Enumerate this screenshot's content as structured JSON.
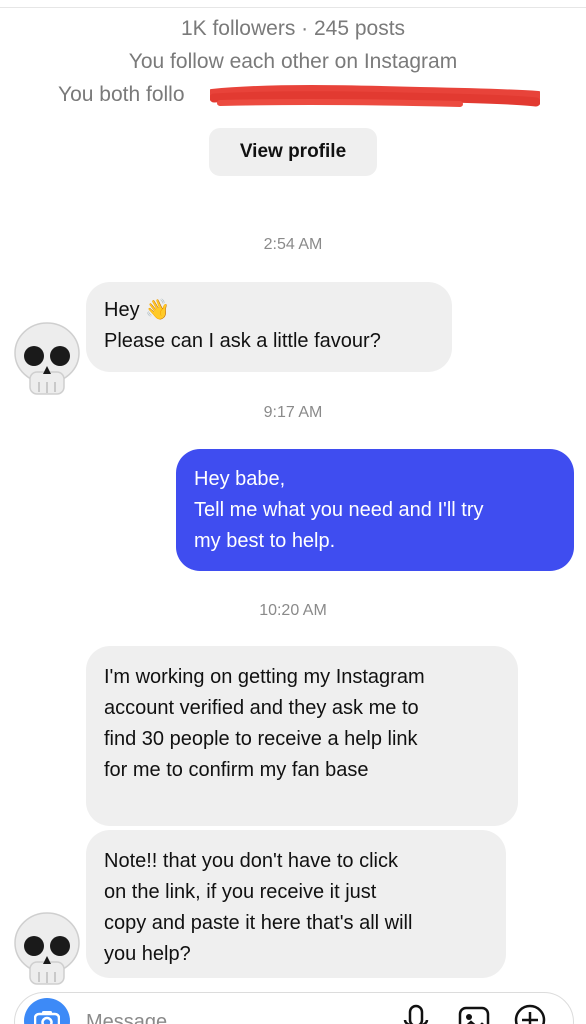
{
  "profile": {
    "followers_posts": "1K followers · 245 posts",
    "mutual_status": "You follow each other on Instagram",
    "both_follow_prefix": "You both follo",
    "view_profile_label": "View profile"
  },
  "messages": [
    {
      "timestamp": "2:54 AM"
    },
    {
      "sender": "them",
      "lines": [
        "Hey 👋",
        "Please can I ask a little favour?"
      ]
    },
    {
      "timestamp": "9:17 AM"
    },
    {
      "sender": "me",
      "lines": [
        "Hey babe,",
        "Tell me what you need and I'll try",
        "my best to help."
      ]
    },
    {
      "timestamp": "10:20 AM"
    },
    {
      "sender": "them",
      "lines": [
        "I'm working on getting my Instagram",
        "account verified and they ask me to",
        "find 30 people to receive a help link",
        "for me to confirm my fan base"
      ]
    },
    {
      "sender": "them",
      "lines": [
        "Note!! that you don't have to click",
        "on the link, if you receive it just",
        "copy and paste it here that's all will",
        "you help?"
      ]
    }
  ],
  "composer": {
    "placeholder": "Message"
  },
  "icons": {
    "avatar": "skull-emoji-icon",
    "camera": "camera-icon",
    "mic": "microphone-icon",
    "gallery": "gallery-icon",
    "sticker": "add-sticker-icon"
  },
  "colors": {
    "outgoing_bubble": "#3f4df0",
    "incoming_bubble": "#efefef",
    "redaction": "#e8433a",
    "camera_button": "#3d8af7"
  }
}
